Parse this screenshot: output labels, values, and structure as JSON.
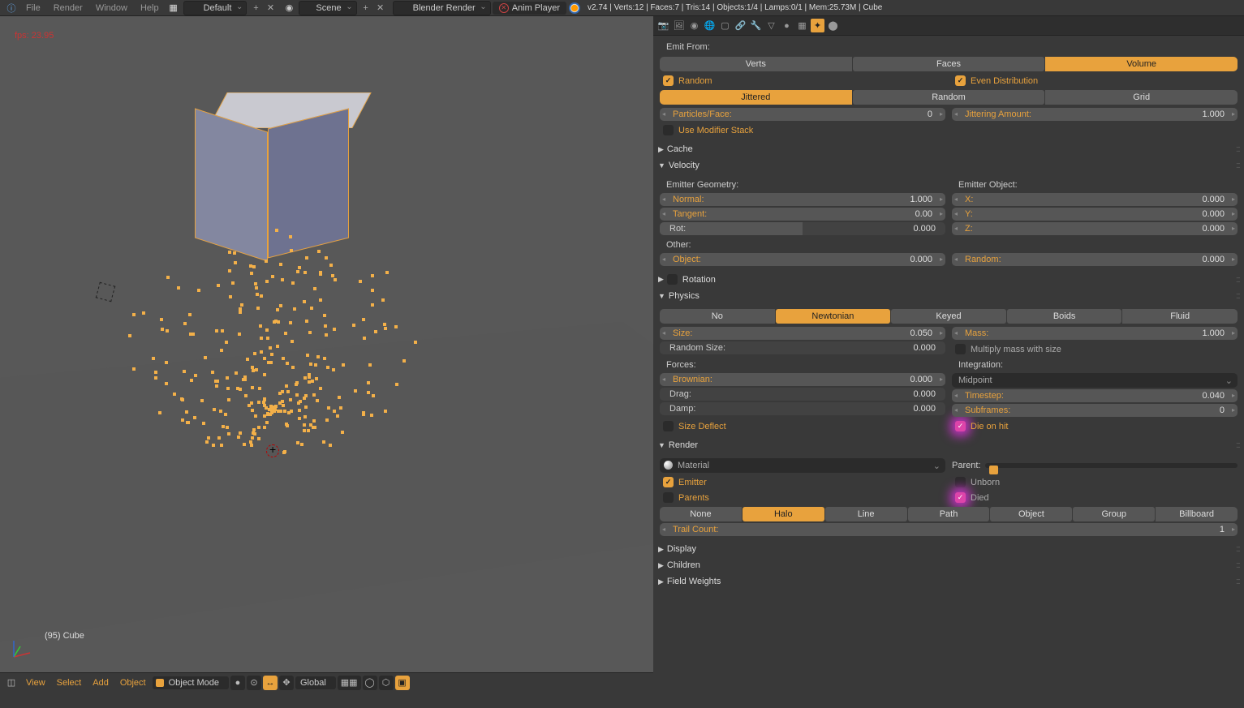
{
  "topbar": {
    "menus": [
      "File",
      "Render",
      "Window",
      "Help"
    ],
    "layout": "Default",
    "scene": "Scene",
    "engine": "Blender Render",
    "anim_player": "Anim Player",
    "stats": "v2.74 | Verts:12 | Faces:7 | Tris:14 | Objects:1/4 | Lamps:0/1 | Mem:25.73M | Cube"
  },
  "viewport": {
    "fps": "fps: 23.95",
    "object_label": "(95) Cube",
    "footer": {
      "menus": [
        "View",
        "Select",
        "Add",
        "Object"
      ],
      "mode": "Object Mode",
      "orientation": "Global"
    }
  },
  "properties": {
    "emit_from": {
      "label": "Emit From:",
      "options": [
        "Verts",
        "Faces",
        "Volume"
      ],
      "active": "Volume",
      "random": "Random",
      "even_dist": "Even Distribution",
      "jitter_row": [
        "Jittered",
        "Random",
        "Grid"
      ],
      "jitter_active": "Jittered",
      "particles_face": {
        "label": "Particles/Face:",
        "value": "0"
      },
      "jitter_amount": {
        "label": "Jittering Amount:",
        "value": "1.000"
      },
      "use_modifier": "Use Modifier Stack"
    },
    "cache": "Cache",
    "velocity": {
      "title": "Velocity",
      "emitter_geom": "Emitter Geometry:",
      "emitter_obj": "Emitter Object:",
      "normal": {
        "label": "Normal:",
        "value": "1.000"
      },
      "tangent": {
        "label": "Tangent:",
        "value": "0.00"
      },
      "rot": {
        "label": "Rot:",
        "value": "0.000"
      },
      "x": {
        "label": "X:",
        "value": "0.000"
      },
      "y": {
        "label": "Y:",
        "value": "0.000"
      },
      "z": {
        "label": "Z:",
        "value": "0.000"
      },
      "other": "Other:",
      "object": {
        "label": "Object:",
        "value": "0.000"
      },
      "random": {
        "label": "Random:",
        "value": "0.000"
      }
    },
    "rotation": "Rotation",
    "physics": {
      "title": "Physics",
      "types": [
        "No",
        "Newtonian",
        "Keyed",
        "Boids",
        "Fluid"
      ],
      "active": "Newtonian",
      "size": {
        "label": "Size:",
        "value": "0.050"
      },
      "random_size": {
        "label": "Random Size:",
        "value": "0.000"
      },
      "mass": {
        "label": "Mass:",
        "value": "1.000"
      },
      "mult_mass": "Multiply mass with size",
      "forces": "Forces:",
      "integration": "Integration:",
      "brownian": {
        "label": "Brownian:",
        "value": "0.000"
      },
      "drag": {
        "label": "Drag:",
        "value": "0.000"
      },
      "damp": {
        "label": "Damp:",
        "value": "0.000"
      },
      "int_method": "Midpoint",
      "timestep": {
        "label": "Timestep:",
        "value": "0.040"
      },
      "subframes": {
        "label": "Subframes:",
        "value": "0"
      },
      "size_deflect": "Size Deflect",
      "die_on_hit": "Die on hit"
    },
    "render": {
      "title": "Render",
      "material": "Material",
      "parent": "Parent:",
      "emitter": "Emitter",
      "unborn": "Unborn",
      "parents": "Parents",
      "died": "Died",
      "types": [
        "None",
        "Halo",
        "Line",
        "Path",
        "Object",
        "Group",
        "Billboard"
      ],
      "active": "Halo",
      "trail_count": {
        "label": "Trail Count:",
        "value": "1"
      }
    },
    "display": "Display",
    "children": "Children",
    "field_weights": "Field Weights"
  }
}
